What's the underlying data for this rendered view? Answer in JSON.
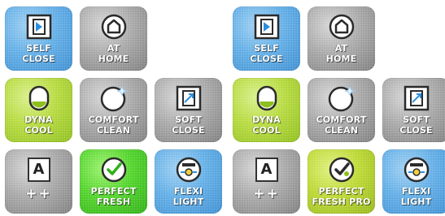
{
  "left_panel": {
    "self_close": "SELF\nCLOSE",
    "at_home": "AT\nHOME",
    "dyna_cool": "DYNA\nCOOL",
    "comfort_clean": "COMFORT\nCLEAN",
    "soft_close": "SOFT\nCLOSE",
    "energy_class": "A",
    "energy_plus": "++",
    "perfect_fresh": "PERFECT\nFRESH",
    "flexi_light": "FLEXI\nLIGHT"
  },
  "right_panel": {
    "self_close": "SELF\nCLOSE",
    "at_home": "AT\nHOME",
    "dyna_cool": "DYNA\nCOOL",
    "comfort_clean": "COMFORT\nCLEAN",
    "soft_close": "SOFT\nCLOSE",
    "energy_class": "A",
    "energy_plus": "++",
    "perfect_fresh": "PERFECT\nFRESH PRO",
    "flexi_light": "FLEXI\nLIGHT"
  },
  "colors": {
    "blue_tile": "#62aee6",
    "grey_tile": "#a9a9a9",
    "lime_tile": "#b6da3e",
    "green_tile": "#52d42a"
  },
  "icons": [
    "self-close-icon",
    "home-icon",
    "dyna-cool-icon",
    "comfort-clean-icon",
    "soft-close-icon",
    "energy-class-icon",
    "check-icon",
    "flexi-light-icon"
  ]
}
